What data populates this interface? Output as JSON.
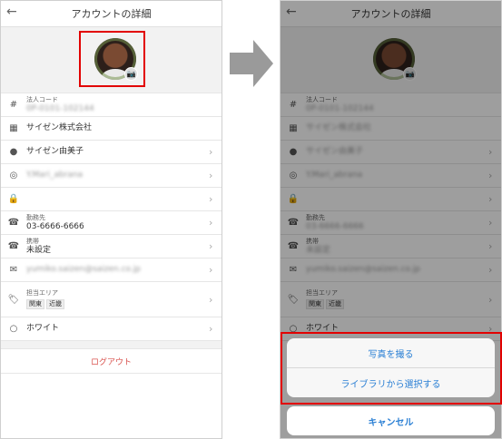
{
  "left": {
    "header": {
      "back_icon": "←",
      "title": "アカウントの詳細"
    },
    "rows": [
      {
        "icon": "#",
        "sub": "法人コード",
        "main": "0P-0101-102144",
        "blurred": true,
        "chevron": false
      },
      {
        "icon": "▦",
        "sub": "",
        "main": "サイゼン株式会社",
        "blurred": false,
        "chevron": false
      },
      {
        "icon": "●",
        "sub": "",
        "main": "サイゼン由美子",
        "blurred": false,
        "chevron": true
      },
      {
        "icon": "◎",
        "sub": "",
        "main": "Y.Mari_abrana",
        "blurred": true,
        "chevron": true
      },
      {
        "icon": "🔒",
        "sub": "",
        "main": "",
        "blurred": false,
        "chevron": true
      },
      {
        "icon": "☎",
        "sub": "勤務先",
        "main": "03-6666-6666",
        "blurred": false,
        "chevron": true
      },
      {
        "icon": "☎",
        "sub": "携帯",
        "main": "未設定",
        "blurred": false,
        "chevron": true
      },
      {
        "icon": "✉",
        "sub": "",
        "main": "yumiko.saizen@saizen.co.jp",
        "blurred": true,
        "chevron": true
      }
    ],
    "area": {
      "sub": "担当エリア",
      "tags": [
        "関東",
        "近畿"
      ]
    },
    "white_row": {
      "icon": "○",
      "main": "ホワイト"
    },
    "logout": "ログアウト"
  },
  "right": {
    "header": {
      "back_icon": "←",
      "title": "アカウントの詳細"
    },
    "area": {
      "sub": "担当エリア",
      "tags": [
        "関東",
        "近畿"
      ]
    },
    "white_row": {
      "icon": "○",
      "main": "ホワイト"
    },
    "action_sheet": {
      "take_photo": "写真を撮る",
      "choose_library": "ライブラリから選択する",
      "cancel": "キャンセル"
    }
  },
  "colors": {
    "highlight": "#e20000",
    "action_text": "#2a7fd4",
    "logout_text": "#d9534f"
  },
  "icons": {
    "camera": "camera-icon",
    "arrow": "right-arrow-icon"
  }
}
